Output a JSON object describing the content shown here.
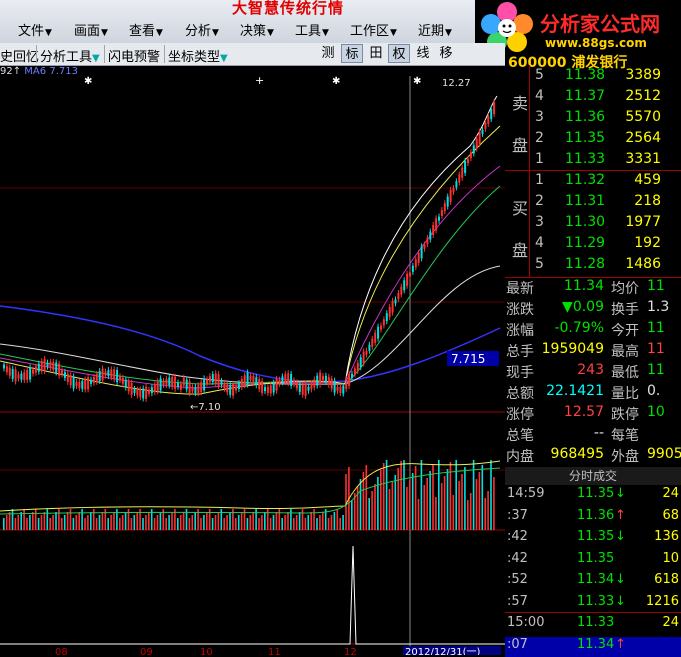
{
  "app_title": "大智慧传统行情",
  "menu": [
    {
      "label": "文件"
    },
    {
      "label": "画面"
    },
    {
      "label": "查看"
    },
    {
      "label": "分析"
    },
    {
      "label": "决策"
    },
    {
      "label": "工具"
    },
    {
      "label": "工作区"
    },
    {
      "label": "近期"
    }
  ],
  "logo": {
    "text": "分析家公式网",
    "url": "www.88gs.com"
  },
  "toolbar": {
    "items": [
      "史回忆",
      "分析工具",
      "闪电预警",
      "坐标类型"
    ],
    "buttons": [
      "测",
      "标",
      "田",
      "权",
      "线",
      "移"
    ]
  },
  "ma_legend": {
    "prefix": "92↑",
    "label": "MA6",
    "value": "7.713"
  },
  "chart": {
    "price_labels": {
      "high": "12.27",
      "low": "7.10",
      "ma_line": "7.715"
    },
    "months": [
      "08",
      "09",
      "10",
      "11",
      "12"
    ],
    "date_tag": "2012/12/31(一)"
  },
  "stock": {
    "code": "600000",
    "name": "浦发银行"
  },
  "sell": [
    {
      "n": "5",
      "price": "11.38",
      "qty": "3389"
    },
    {
      "n": "4",
      "price": "11.37",
      "qty": "2512"
    },
    {
      "n": "3",
      "price": "11.36",
      "qty": "5570"
    },
    {
      "n": "2",
      "price": "11.35",
      "qty": "2564"
    },
    {
      "n": "1",
      "price": "11.33",
      "qty": "3331"
    }
  ],
  "buy": [
    {
      "n": "1",
      "price": "11.32",
      "qty": "459"
    },
    {
      "n": "2",
      "price": "11.31",
      "qty": "218"
    },
    {
      "n": "3",
      "price": "11.30",
      "qty": "1977"
    },
    {
      "n": "4",
      "price": "11.29",
      "qty": "192"
    },
    {
      "n": "5",
      "price": "11.28",
      "qty": "1486"
    }
  ],
  "sell_label": [
    "卖",
    "盘"
  ],
  "buy_label": [
    "买",
    "盘"
  ],
  "quote": [
    {
      "l1": "最新",
      "v1": "11.34",
      "l2": "均价",
      "v2": "11"
    },
    {
      "l1": "涨跌",
      "v1": "▼0.09",
      "l2": "换手",
      "v2": "1.3"
    },
    {
      "l1": "涨幅",
      "v1": "-0.79%",
      "l2": "今开",
      "v2": "11"
    },
    {
      "l1": "总手",
      "v1": "1959049",
      "l2": "最高",
      "v2": "11"
    },
    {
      "l1": "现手",
      "v1": "243",
      "l2": "最低",
      "v2": "11"
    },
    {
      "l1": "总额",
      "v1": "22.1421",
      "l2": "量比",
      "v2": "0."
    },
    {
      "l1": "涨停",
      "v1": "12.57",
      "l2": "跌停",
      "v2": "10"
    },
    {
      "l1": "总笔",
      "v1": "--",
      "l2": "每笔",
      "v2": ""
    },
    {
      "l1": "内盘",
      "v1": "968495",
      "l2": "外盘",
      "v2": "9905"
    }
  ],
  "ticks_header": "分时成交",
  "ticks": [
    {
      "t": "14:59",
      "p": "11.35",
      "d": "↓",
      "v": "24"
    },
    {
      "t": ":37",
      "p": "11.36",
      "d": "↑",
      "v": "68"
    },
    {
      "t": ":42",
      "p": "11.35",
      "d": "↓",
      "v": "136"
    },
    {
      "t": ":42",
      "p": "11.35",
      "d": "",
      "v": "10"
    },
    {
      "t": ":52",
      "p": "11.34",
      "d": "↓",
      "v": "618"
    },
    {
      "t": ":57",
      "p": "11.33",
      "d": "↓",
      "v": "1216"
    },
    {
      "t": "15:00",
      "p": "11.33",
      "d": "",
      "v": "24"
    },
    {
      "t": ":07",
      "p": "11.34",
      "d": "↑",
      "v": ""
    }
  ]
}
